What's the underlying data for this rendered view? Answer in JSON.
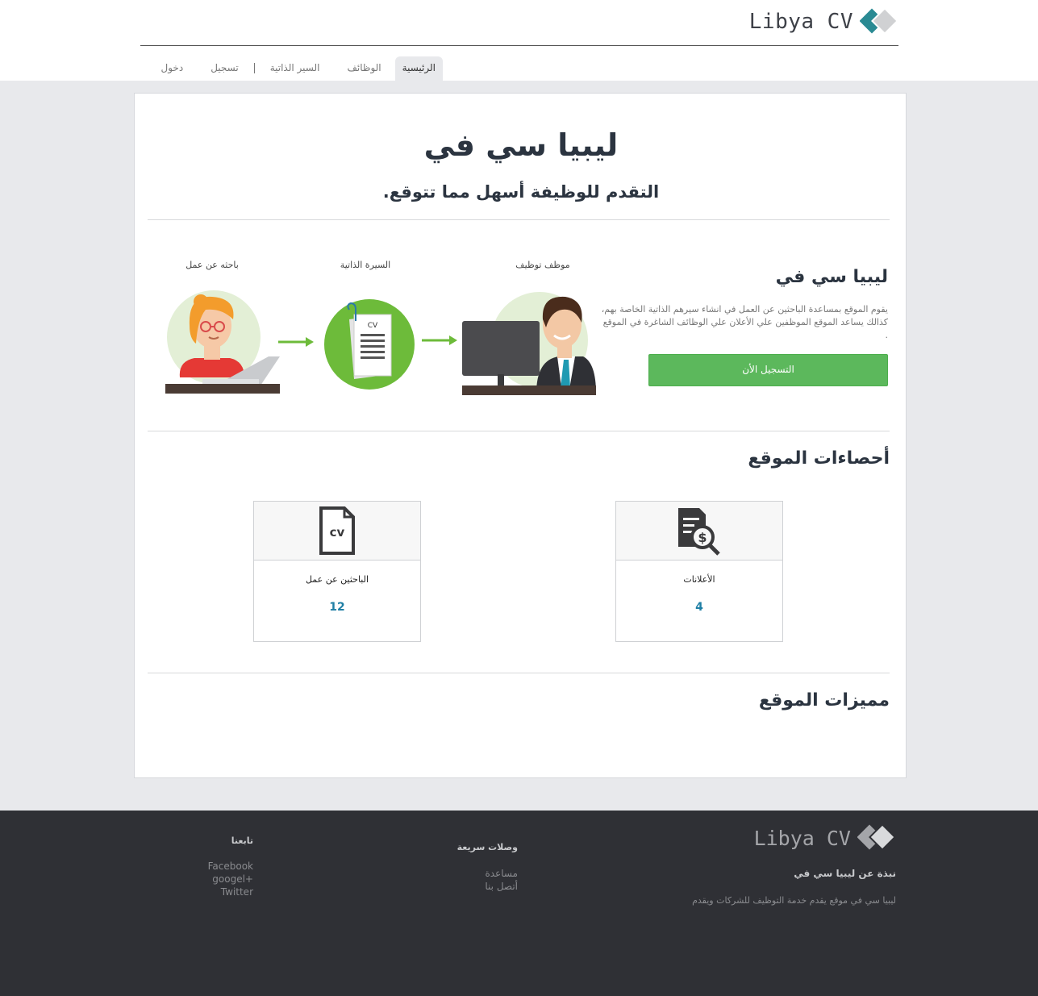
{
  "header": {
    "logo_text": "Libya CV",
    "nav": [
      {
        "label": "الرئيسية",
        "active": true
      },
      {
        "label": "الوظائف",
        "active": false
      },
      {
        "label": "السير الذاتية",
        "active": false
      },
      {
        "label": "تسجيل",
        "active": false
      },
      {
        "label": "دخول",
        "active": false
      }
    ]
  },
  "hero": {
    "title": "ليبيا سي في",
    "subtitle": "التقدم للوظيفة أسهل مما تتوقع."
  },
  "intro": {
    "title": "ليبيا سي في",
    "text": "يقوم الموقع بمساعدة الباحثين عن العمل في انشاء سيرهم الذاتية الخاصة بهم، كذالك يساعد الموقع الموظفين علي الأعلان علي الوظائف الشاغرة في الموقع .",
    "button": "التسجيل الأن",
    "steps": [
      "موظف توظيف",
      "السيرة الذاتية",
      "باحثه عن عمل"
    ],
    "cv_badge": "CV"
  },
  "stats": {
    "title": "أحصاءات الموقع",
    "items": [
      {
        "label": "الأعلانات",
        "value": "4",
        "icon": "job-ads-icon"
      },
      {
        "label": "الباحثين عن عمل",
        "value": "12",
        "icon": "cv-file-icon"
      }
    ],
    "cv_icon_text": "cv",
    "dollar_sign": "$"
  },
  "features": {
    "title": "مميزات الموقع"
  },
  "footer": {
    "logo_text": "Libya CV",
    "about_title": "نبذة عن ليبيا سي في",
    "about_text": "ليبيا سي في موقع يقدم خدمة التوظيف للشركات ويقدم",
    "quick_links_title": "وصلات سريعة",
    "quick_links": [
      "مساعدة",
      "أتصل بنا"
    ],
    "follow_title": "تابعنا",
    "social": [
      "Facebook",
      "googel+",
      "Twitter"
    ]
  },
  "colors": {
    "accent_green": "#5cb85c",
    "stat_value_blue": "#1f7fa5",
    "footer_bg": "#2f3035",
    "logo_teal": "#2a8a93"
  }
}
